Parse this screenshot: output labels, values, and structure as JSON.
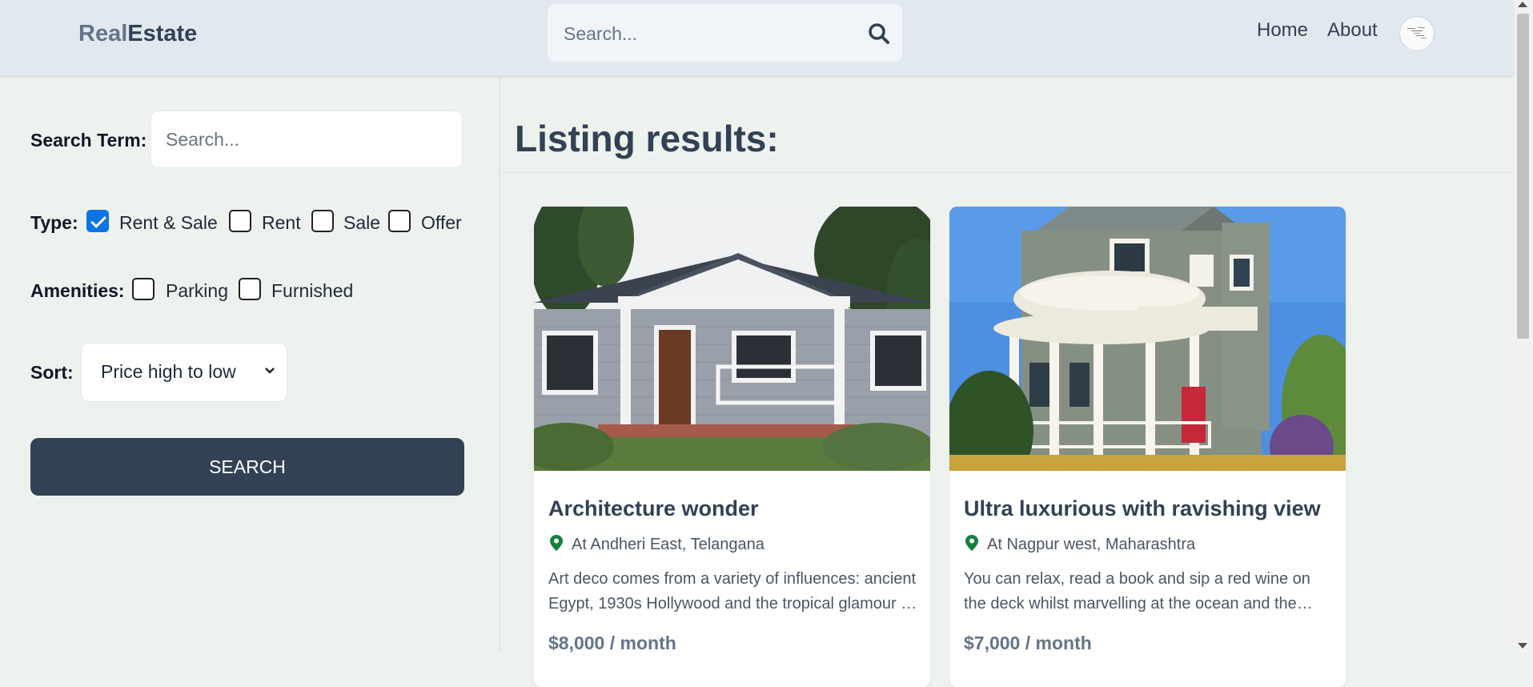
{
  "header": {
    "logo_part1": "Real",
    "logo_part2": "Estate",
    "search_placeholder": "Search...",
    "nav": [
      {
        "label": "Home"
      },
      {
        "label": "About"
      }
    ],
    "avatar_icon": "user-avatar"
  },
  "sidebar": {
    "search_term_label": "Search Term:",
    "search_term_placeholder": "Search...",
    "type_label": "Type:",
    "types": [
      {
        "label": "Rent & Sale",
        "checked": true
      },
      {
        "label": "Rent",
        "checked": false
      },
      {
        "label": "Sale",
        "checked": false
      },
      {
        "label": "Offer",
        "checked": false
      }
    ],
    "amenities_label": "Amenities:",
    "amenities": [
      {
        "label": "Parking",
        "checked": false
      },
      {
        "label": "Furnished",
        "checked": false
      }
    ],
    "sort_label": "Sort:",
    "sort_value": "Price high to low",
    "search_button": "SEARCH"
  },
  "main": {
    "title": "Listing results:",
    "listings": [
      {
        "title": "Architecture wonder",
        "location": "At Andheri East, Telangana",
        "description": "Art deco comes from a variety of influences: ancient Egypt, 1930s Hollywood and the tropical glamour of the time.",
        "price": "$8,000 / month"
      },
      {
        "title": "Ultra luxurious with ravishing view",
        "location": "At Nagpur west, Maharashtra",
        "description": "You can relax, read a book and sip a red wine on the deck whilst marvelling at the ocean and the rolling hills beyond.",
        "price": "$7,000 / month"
      }
    ]
  },
  "colors": {
    "header_bg": "#e2e8f0",
    "page_bg": "#eef2ef",
    "primary_dark": "#334155",
    "checkbox_checked": "#0b74e5",
    "pin_green": "#15803d"
  }
}
